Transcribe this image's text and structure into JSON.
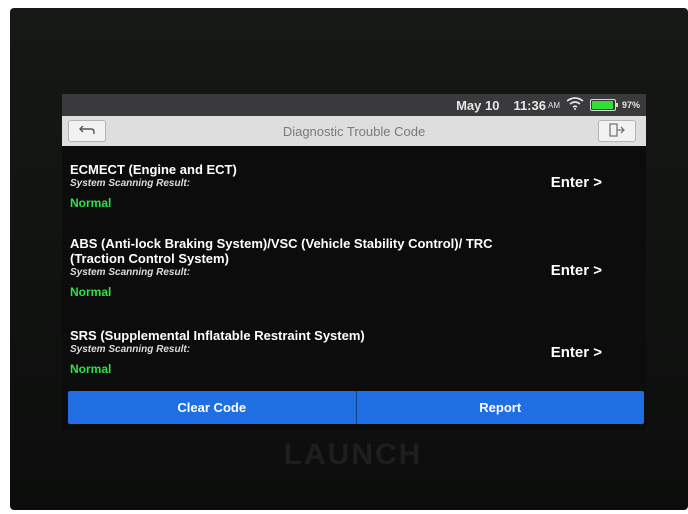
{
  "status_bar": {
    "date": "May 10",
    "time": "11:36",
    "ampm": "AM",
    "battery_percent": "97%",
    "battery_level": 0.97,
    "battery_color": "#33dd33"
  },
  "title_bar": {
    "title": "Diagnostic Trouble Code",
    "back_icon": "back-arrow-icon",
    "exit_icon": "exit-icon"
  },
  "systems": [
    {
      "title": "ECMECT (Engine and ECT)",
      "result_label": "System Scanning Result:",
      "result": "Normal",
      "action": "Enter >"
    },
    {
      "title": "ABS (Anti-lock Braking System)/VSC (Vehicle Stability Control)/ TRC (Traction Control System)",
      "result_label": "System Scanning Result:",
      "result": "Normal",
      "action": "Enter >"
    },
    {
      "title": "SRS (Supplemental Inflatable Restraint System)",
      "result_label": "System Scanning Result:",
      "result": "Normal",
      "action": "Enter >"
    }
  ],
  "footer": {
    "clear_code": "Clear Code",
    "report": "Report"
  },
  "device": {
    "brand": "LAUNCH"
  },
  "colors": {
    "accent": "#1f6fe3",
    "normal": "#2fe04a"
  }
}
